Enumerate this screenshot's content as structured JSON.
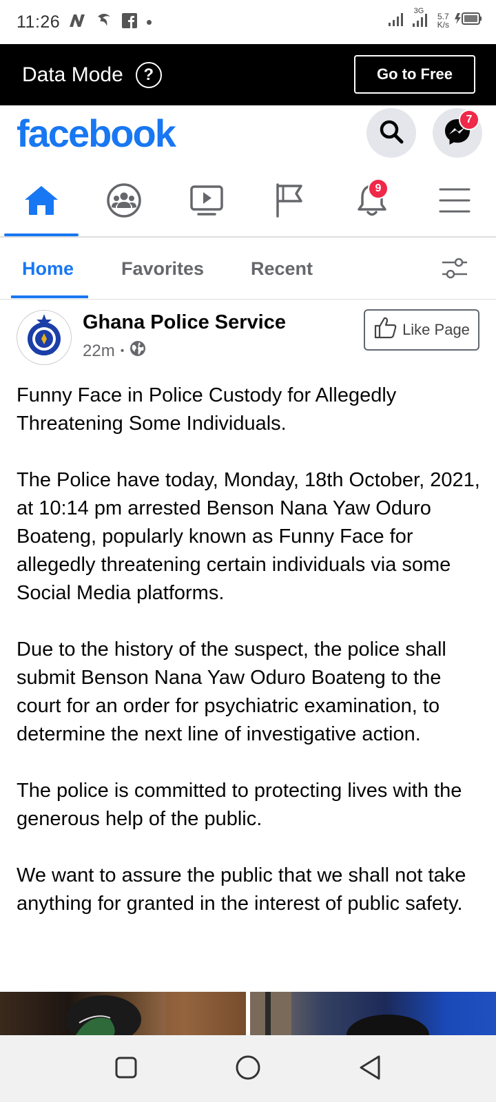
{
  "status_bar": {
    "time": "11:26",
    "network_type": "3G",
    "net_speed_value": "5.7",
    "net_speed_unit": "K/s"
  },
  "data_mode": {
    "label": "Data Mode",
    "help_glyph": "?",
    "go_free_label": "Go to Free"
  },
  "header": {
    "logo": "facebook",
    "brand_color": "#1877f2",
    "messenger_badge": "7"
  },
  "nav": {
    "items": [
      "home-icon",
      "groups-icon",
      "watch-icon",
      "pages-flag-icon",
      "notifications-icon",
      "menu-icon"
    ],
    "notifications_badge": "9",
    "active": "home-icon"
  },
  "feed_tabs": {
    "tabs": [
      {
        "label": "Home",
        "active": true
      },
      {
        "label": "Favorites",
        "active": false
      },
      {
        "label": "Recent",
        "active": false
      }
    ]
  },
  "post": {
    "page_name": "Ghana Police Service",
    "time_ago": "22m",
    "separator": "•",
    "audience_icon": "globe-icon",
    "like_page_label": "Like Page",
    "paragraphs": [
      "Funny Face in Police Custody for Allegedly Threatening Some Individuals.",
      "The Police have today, Monday, 18th October, 2021, at 10:14 pm arrested Benson Nana Yaw Oduro Boateng, popularly known as Funny Face for allegedly threatening certain individuals via some Social Media platforms.",
      "Due to the history of the suspect, the police shall submit Benson Nana Yaw Oduro Boateng to the court for an order for psychiatric examination, to determine the next line of investigative action.",
      "The police is committed to protecting lives with the generous help of the public.",
      "We want to assure the public that we shall not take anything for granted in the interest of public safety."
    ]
  },
  "system_nav": {
    "buttons": [
      "recents-square-icon",
      "home-circle-icon",
      "back-triangle-icon"
    ]
  }
}
